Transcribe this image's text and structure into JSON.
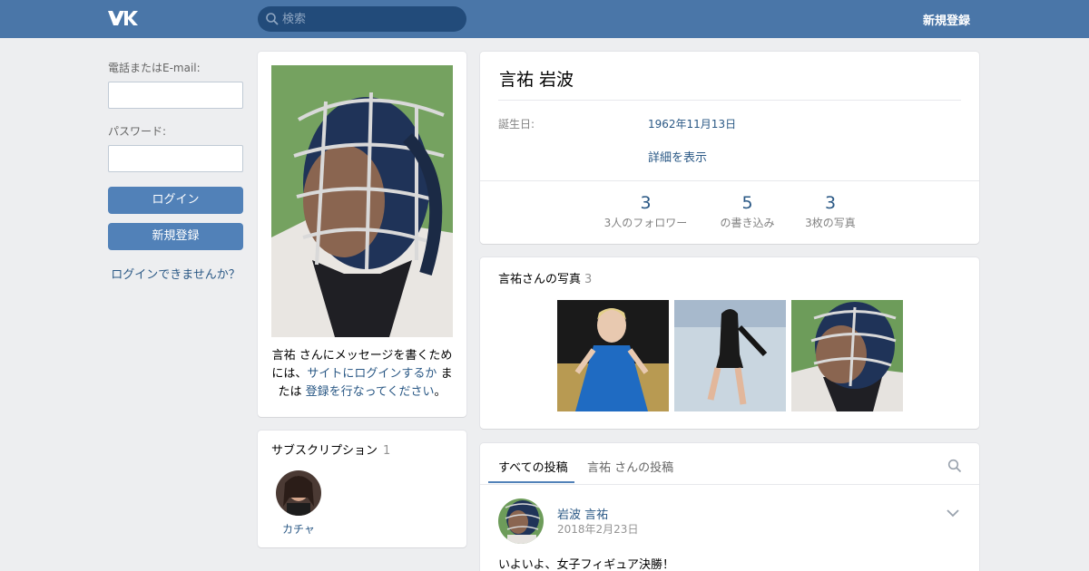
{
  "header": {
    "logo_text": "VK",
    "search_placeholder": "検索",
    "register_link": "新規登録"
  },
  "login": {
    "email_label": "電話またはE-mail:",
    "password_label": "パスワード:",
    "login_button": "ログイン",
    "register_button": "新規登録",
    "forgot_link": "ログインできませんか？"
  },
  "profile": {
    "message_prefix": "言祐 さんにメッセージを書くためには、",
    "message_login_link": "サイトにログインするか",
    "message_mid": " または ",
    "message_register_link": "登録を行なってください",
    "message_suffix": "。",
    "name": "言祐 岩波",
    "birthday_label": "誕生日:",
    "birthday_value": "1962年11月13日",
    "show_more": "詳細を表示",
    "counters": [
      {
        "value": "3",
        "label": "3人のフォロワー"
      },
      {
        "value": "5",
        "label": "の書き込み"
      },
      {
        "value": "3",
        "label": "3枚の写真"
      }
    ]
  },
  "subscriptions": {
    "title": "サブスクリプション",
    "count": "1",
    "items": [
      {
        "name": "カチャ"
      }
    ]
  },
  "photos": {
    "title": "言祐さんの写真",
    "count": "3"
  },
  "wall": {
    "tabs": [
      "すべての投稿",
      "言祐 さんの投稿"
    ],
    "post": {
      "author": "岩波 言祐",
      "date": "2018年2月23日",
      "text": "いよいよ、女子フィギュア決勝！"
    }
  },
  "colors": {
    "header_bg": "#4a76a8",
    "accent": "#5181b8",
    "link": "#2a5885",
    "page_bg": "#edeef0"
  }
}
